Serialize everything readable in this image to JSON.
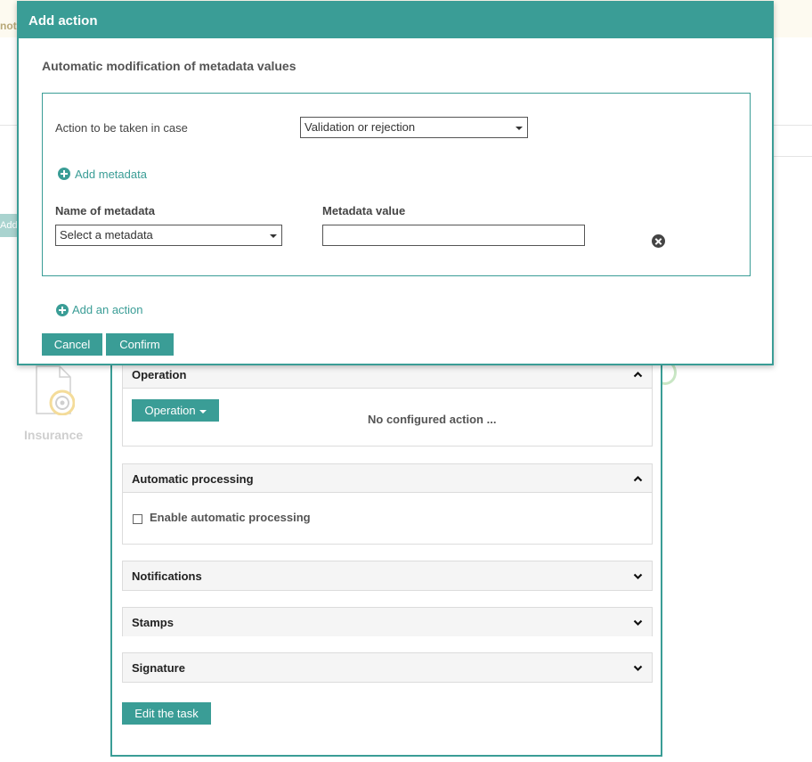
{
  "background": {
    "strip_text": "noti",
    "add_button_label": "Add",
    "document_label": "Insurance"
  },
  "task_panel": {
    "sections": {
      "operation": {
        "title": "Operation",
        "button_label": "Operation",
        "empty_text": "No configured action ..."
      },
      "automatic_processing": {
        "title": "Automatic processing",
        "checkbox_label": "Enable automatic processing"
      },
      "notifications": {
        "title": "Notifications"
      },
      "stamps": {
        "title": "Stamps"
      },
      "signature": {
        "title": "Signature"
      }
    },
    "edit_button_label": "Edit the task"
  },
  "modal": {
    "title": "Add action",
    "subtitle": "Automatic modification of metadata values",
    "action_case_label": "Action to be taken in case",
    "action_case_value": "Validation or rejection",
    "add_metadata_label": "Add metadata",
    "metadata_name_header": "Name of metadata",
    "metadata_value_header": "Metadata value",
    "metadata_select_value": "Select a metadata",
    "metadata_value_input": "",
    "add_action_label": "Add an action",
    "cancel_label": "Cancel",
    "confirm_label": "Confirm"
  },
  "colors": {
    "accent": "#3a9d96",
    "header_bg": "#f5f5f5"
  }
}
